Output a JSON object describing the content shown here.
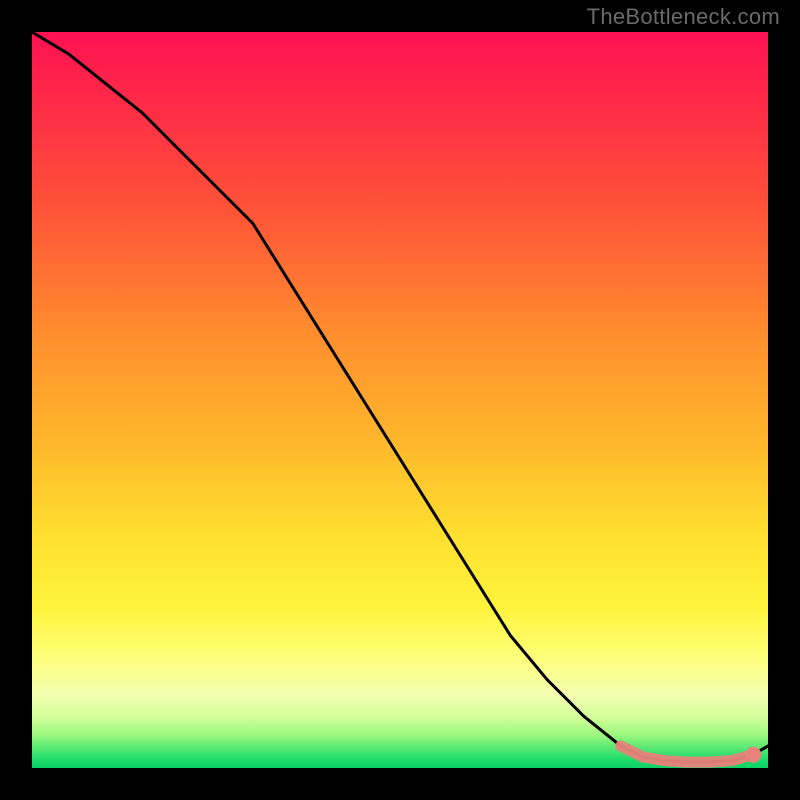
{
  "watermark": "TheBottleneck.com",
  "chart_data": {
    "type": "line",
    "title": "",
    "xlabel": "",
    "ylabel": "",
    "xlim": [
      0,
      100
    ],
    "ylim": [
      0,
      100
    ],
    "grid": false,
    "series": [
      {
        "name": "curve",
        "color": "#000000",
        "x": [
          0,
          5,
          10,
          15,
          20,
          25,
          30,
          35,
          40,
          45,
          50,
          55,
          60,
          65,
          70,
          75,
          80,
          83,
          86,
          89,
          92,
          95,
          98,
          100
        ],
        "y": [
          100,
          97,
          93,
          89,
          84,
          79,
          74,
          66,
          58,
          50,
          42,
          34,
          26,
          18,
          12,
          7,
          3,
          1.5,
          1.0,
          0.8,
          0.8,
          1.0,
          1.8,
          3.0
        ]
      }
    ],
    "highlight_band": {
      "color": "#e7837b",
      "x": [
        80,
        83,
        86,
        89,
        92,
        95,
        98
      ],
      "y": [
        3.0,
        1.5,
        1.0,
        0.8,
        0.8,
        1.0,
        1.8
      ]
    },
    "highlight_point": {
      "color": "#e7837b",
      "x": 98,
      "y": 1.8
    }
  }
}
